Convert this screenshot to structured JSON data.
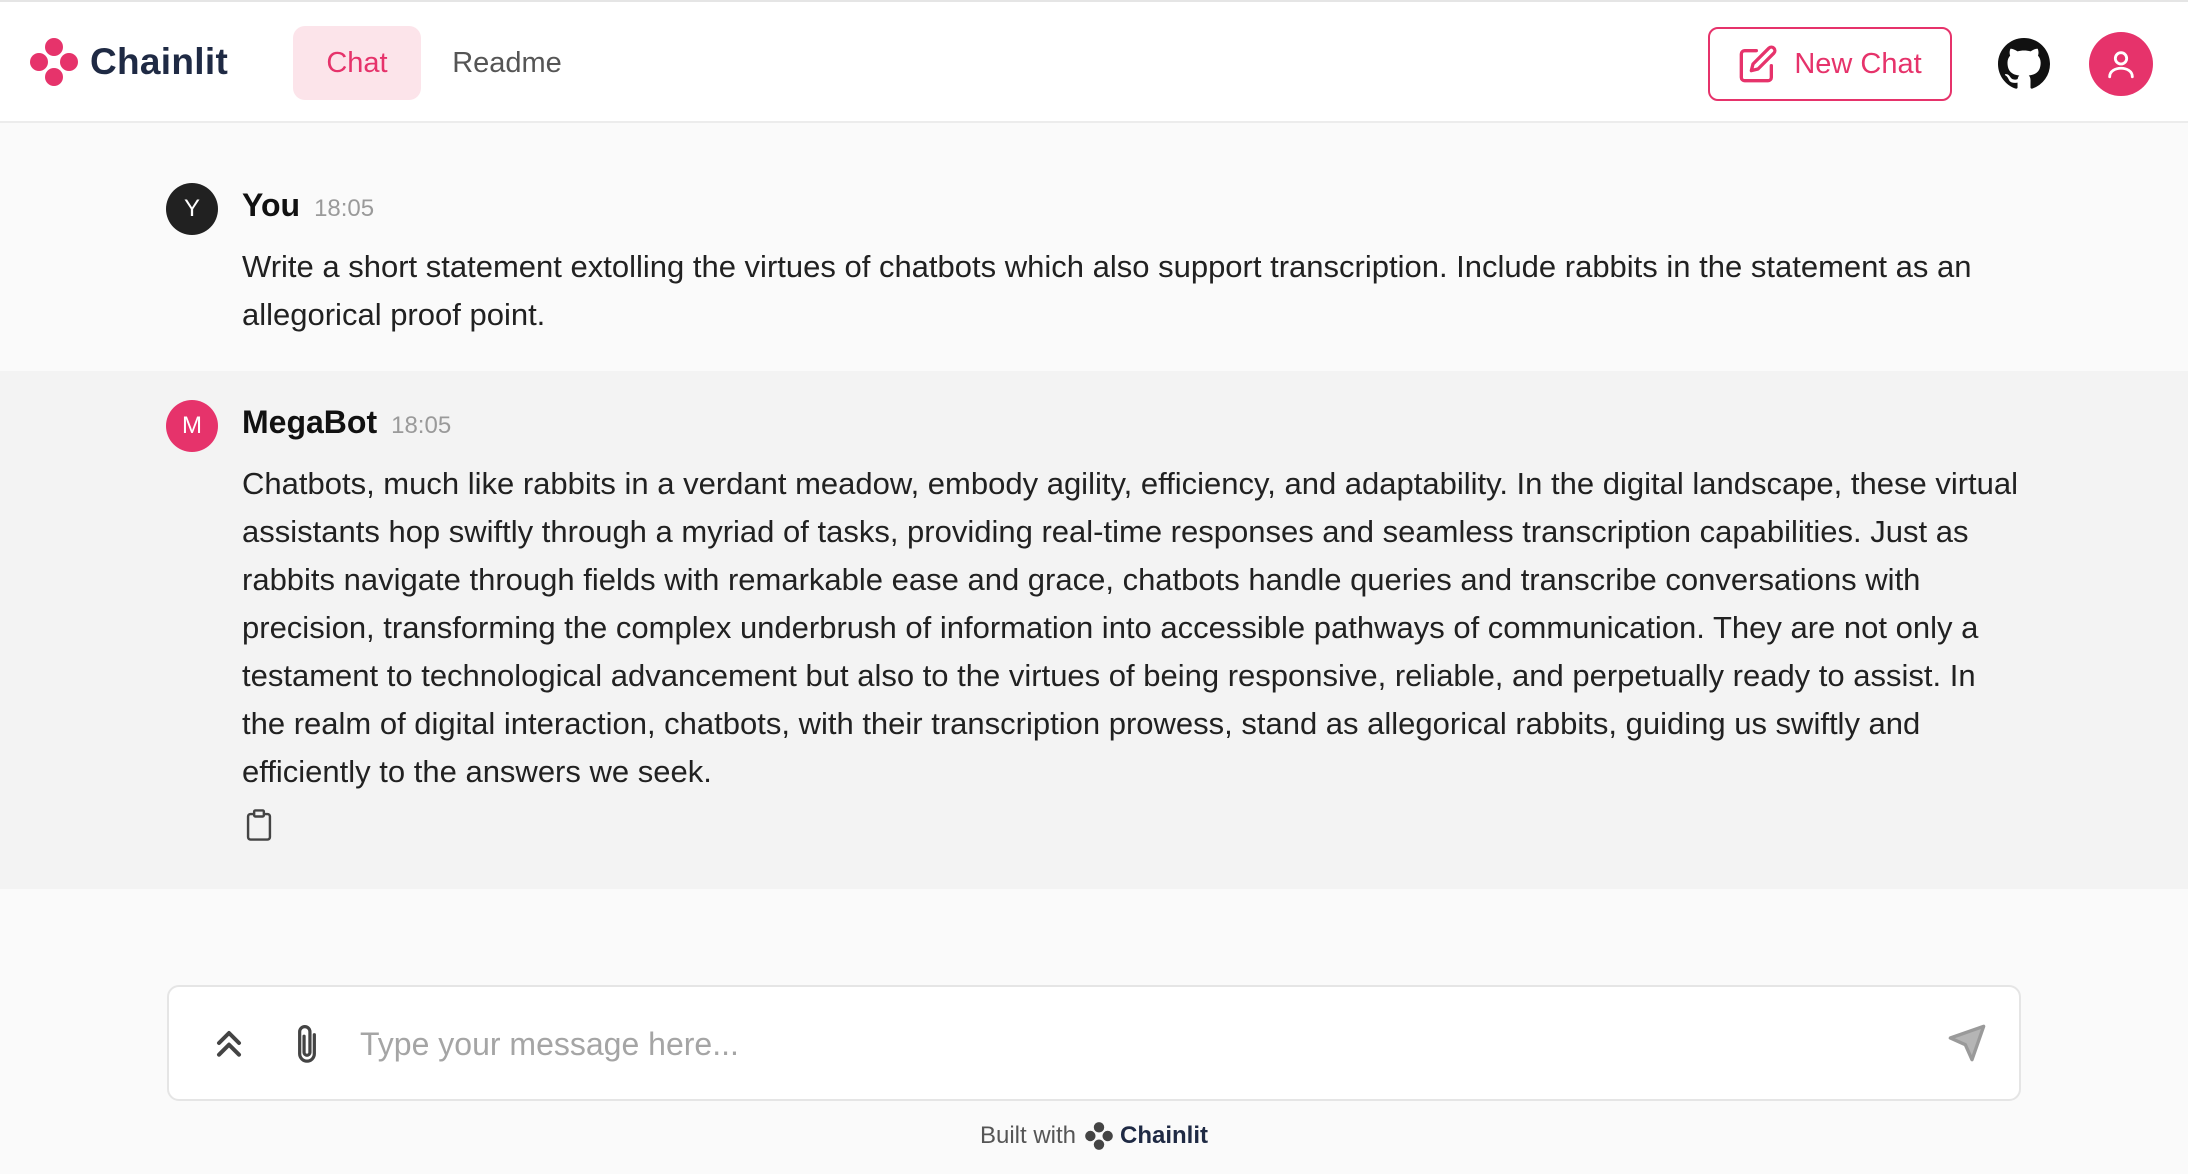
{
  "header": {
    "brand": "Chainlit",
    "tabs": [
      {
        "label": "Chat",
        "active": true
      },
      {
        "label": "Readme",
        "active": false
      }
    ],
    "new_chat_label": "New Chat",
    "icons": [
      "logo-icon",
      "edit-icon",
      "github-icon",
      "user-icon"
    ]
  },
  "messages": [
    {
      "author": "You",
      "avatar_letter": "Y",
      "time": "18:05",
      "text": "Write a short statement extolling the virtues of chatbots which also support transcription. Include rabbits in the statement as an allegorical proof point."
    },
    {
      "author": "MegaBot",
      "avatar_letter": "M",
      "time": "18:05",
      "text": "Chatbots, much like rabbits in a verdant meadow, embody agility, efficiency, and adaptability. In the digital landscape, these virtual assistants hop swiftly through a myriad of tasks, providing real-time responses and seamless transcription capabilities. Just as rabbits navigate through fields with remarkable ease and grace, chatbots handle queries and transcribe conversations with precision, transforming the complex underbrush of information into accessible pathways of communication. They are not only a testament to technological advancement but also to the virtues of being responsive, reliable, and perpetually ready to assist. In the realm of digital interaction, chatbots, with their transcription prowess, stand as allegorical rabbits, guiding us swiftly and efficiently to the answers we seek."
    }
  ],
  "composer": {
    "placeholder": "Type your message here...",
    "value": ""
  },
  "footer": {
    "built_with": "Built with",
    "brand": "Chainlit"
  },
  "colors": {
    "accent": "#e6336b",
    "accent_light": "#fce4ea",
    "brand_text": "#1f2a44",
    "background": "#fafafa",
    "bot_row": "#f3f3f3"
  }
}
